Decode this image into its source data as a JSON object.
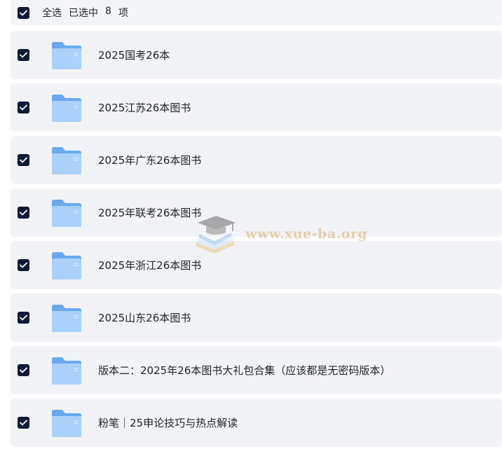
{
  "header": {
    "select_all_label": "全选",
    "selected_prefix": "已选中",
    "selected_count": "8",
    "selected_suffix": "项",
    "checked": true
  },
  "items": [
    {
      "label": "2025国考26本",
      "checked": true,
      "icon": "folder-icon"
    },
    {
      "label": "2025江苏26本图书",
      "checked": true,
      "icon": "folder-icon"
    },
    {
      "label": "2025年广东26本图书",
      "checked": true,
      "icon": "folder-icon"
    },
    {
      "label": "2025年联考26本图书",
      "checked": true,
      "icon": "folder-icon"
    },
    {
      "label": "2025年浙江26本图书",
      "checked": true,
      "icon": "folder-icon"
    },
    {
      "label": "2025山东26本图书",
      "checked": true,
      "icon": "folder-icon"
    },
    {
      "label": "版本二：2025年26本图书大礼包合集（应该都是无密码版本）",
      "checked": true,
      "icon": "folder-icon"
    },
    {
      "label": "粉笔｜25申论技巧与热点解读",
      "checked": true,
      "icon": "folder-icon"
    }
  ],
  "watermark": {
    "text": "www.xue-ba.org",
    "icon": "graduation-cap-book-logo"
  },
  "colors": {
    "checkbox": "#0f1a3a",
    "row_bg": "#f2f3f6",
    "folder_back": "#6aa9ef",
    "folder_front": "#a9d1fa",
    "text": "#1f2329"
  }
}
